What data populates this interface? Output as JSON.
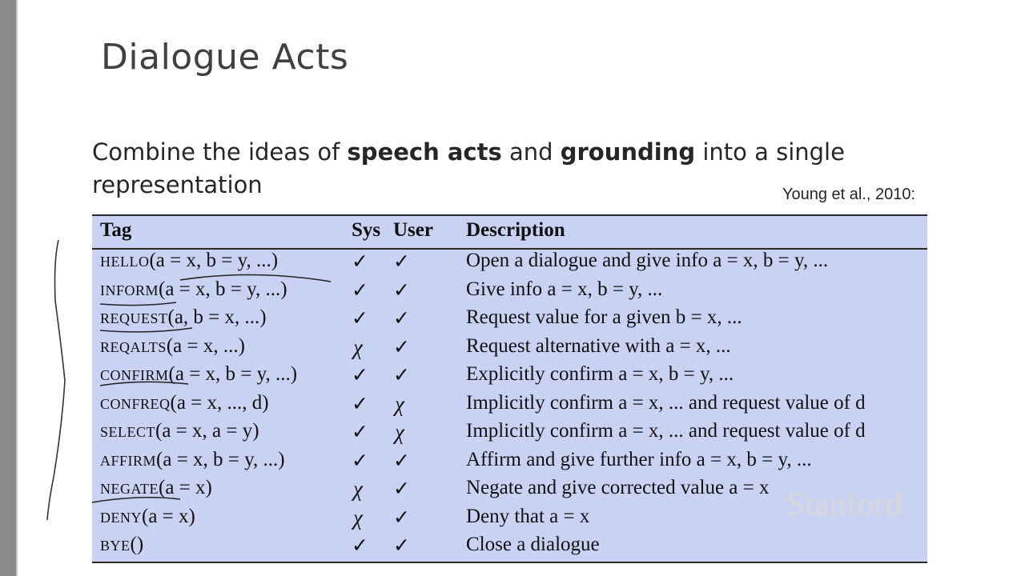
{
  "slide": {
    "title": "Dialogue Acts",
    "intro": {
      "part1": "Combine the ideas of ",
      "bold1": "speech acts",
      "part2": " and ",
      "bold2": "grounding",
      "part3": " into a single representation"
    },
    "citation": "Young et al., 2010:",
    "logo": "Stanford"
  },
  "table": {
    "headers": {
      "tag": "Tag",
      "sys": "Sys",
      "user": "User",
      "description": "Description"
    },
    "rows": [
      {
        "tag": "hello",
        "args": "(a = x, b = y, ...)",
        "sys": "✓",
        "user": "✓",
        "description": "Open a dialogue and give info a = x, b = y, ..."
      },
      {
        "tag": "inform",
        "args": "(a = x, b = y, ...)",
        "sys": "✓",
        "user": "✓",
        "description": "Give info a = x, b = y, ..."
      },
      {
        "tag": "request",
        "args": "(a, b = x, ...)",
        "sys": "✓",
        "user": "✓",
        "description": "Request value for a given b = x, ..."
      },
      {
        "tag": "reqalts",
        "args": "(a = x, ...)",
        "sys": "χ",
        "user": "✓",
        "description": "Request alternative with a = x, ..."
      },
      {
        "tag": "confirm",
        "args": "(a = x, b = y, ...)",
        "sys": "✓",
        "user": "✓",
        "description": "Explicitly confirm a = x, b = y, ..."
      },
      {
        "tag": "confreq",
        "args": "(a = x, ..., d)",
        "sys": "✓",
        "user": "χ",
        "description": "Implicitly confirm a = x, ... and request value of d"
      },
      {
        "tag": "select",
        "args": "(a = x, a = y)",
        "sys": "✓",
        "user": "χ",
        "description": "Implicitly confirm a = x, ... and request value of d"
      },
      {
        "tag": "affirm",
        "args": "(a = x, b = y, ...)",
        "sys": "✓",
        "user": "✓",
        "description": "Affirm and give further info a = x, b = y, ..."
      },
      {
        "tag": "negate",
        "args": "(a = x)",
        "sys": "χ",
        "user": "✓",
        "description": "Negate and give corrected value a = x"
      },
      {
        "tag": "deny",
        "args": "(a = x)",
        "sys": "χ",
        "user": "✓",
        "description": "Deny that a = x"
      },
      {
        "tag": "bye",
        "args": "()",
        "sys": "✓",
        "user": "✓",
        "description": "Close a dialogue"
      }
    ]
  }
}
